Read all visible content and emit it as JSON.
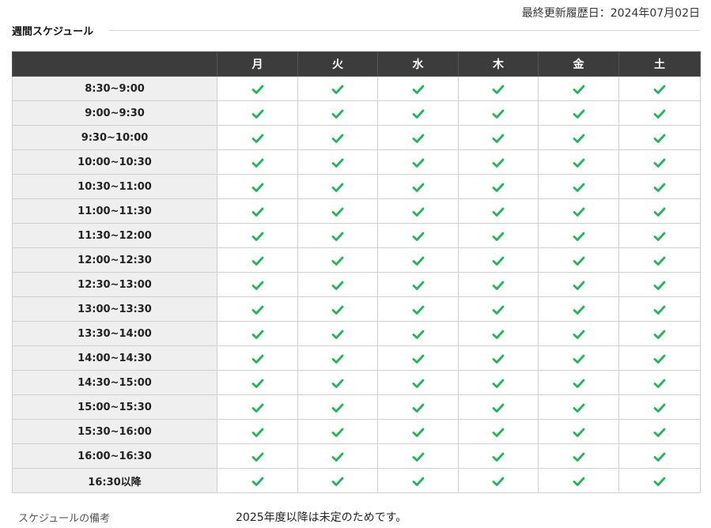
{
  "last_updated": "最終更新履歴日：2024年07月02日",
  "section_title": "週間スケジュール",
  "colors": {
    "header_bg": "#3c3c3c",
    "header_text": "#ffffff",
    "time_cell_bg": "#efefef",
    "check": "#1db954"
  },
  "table": {
    "corner": "",
    "days": [
      "月",
      "火",
      "水",
      "木",
      "金",
      "土"
    ],
    "rows": [
      {
        "time": "8:30~9:00",
        "available": [
          true,
          true,
          true,
          true,
          true,
          true
        ]
      },
      {
        "time": "9:00~9:30",
        "available": [
          true,
          true,
          true,
          true,
          true,
          true
        ]
      },
      {
        "time": "9:30~10:00",
        "available": [
          true,
          true,
          true,
          true,
          true,
          true
        ]
      },
      {
        "time": "10:00~10:30",
        "available": [
          true,
          true,
          true,
          true,
          true,
          true
        ]
      },
      {
        "time": "10:30~11:00",
        "available": [
          true,
          true,
          true,
          true,
          true,
          true
        ]
      },
      {
        "time": "11:00~11:30",
        "available": [
          true,
          true,
          true,
          true,
          true,
          true
        ]
      },
      {
        "time": "11:30~12:00",
        "available": [
          true,
          true,
          true,
          true,
          true,
          true
        ]
      },
      {
        "time": "12:00~12:30",
        "available": [
          true,
          true,
          true,
          true,
          true,
          true
        ]
      },
      {
        "time": "12:30~13:00",
        "available": [
          true,
          true,
          true,
          true,
          true,
          true
        ]
      },
      {
        "time": "13:00~13:30",
        "available": [
          true,
          true,
          true,
          true,
          true,
          true
        ]
      },
      {
        "time": "13:30~14:00",
        "available": [
          true,
          true,
          true,
          true,
          true,
          true
        ]
      },
      {
        "time": "14:00~14:30",
        "available": [
          true,
          true,
          true,
          true,
          true,
          true
        ]
      },
      {
        "time": "14:30~15:00",
        "available": [
          true,
          true,
          true,
          true,
          true,
          true
        ]
      },
      {
        "time": "15:00~15:30",
        "available": [
          true,
          true,
          true,
          true,
          true,
          true
        ]
      },
      {
        "time": "15:30~16:00",
        "available": [
          true,
          true,
          true,
          true,
          true,
          true
        ]
      },
      {
        "time": "16:00~16:30",
        "available": [
          true,
          true,
          true,
          true,
          true,
          true
        ]
      },
      {
        "time": "16:30以降",
        "available": [
          true,
          true,
          true,
          true,
          true,
          true
        ]
      }
    ],
    "available_icon": "check-icon"
  },
  "note": {
    "label": "スケジュールの備考",
    "text": "2025年度以降は未定のためです。"
  }
}
